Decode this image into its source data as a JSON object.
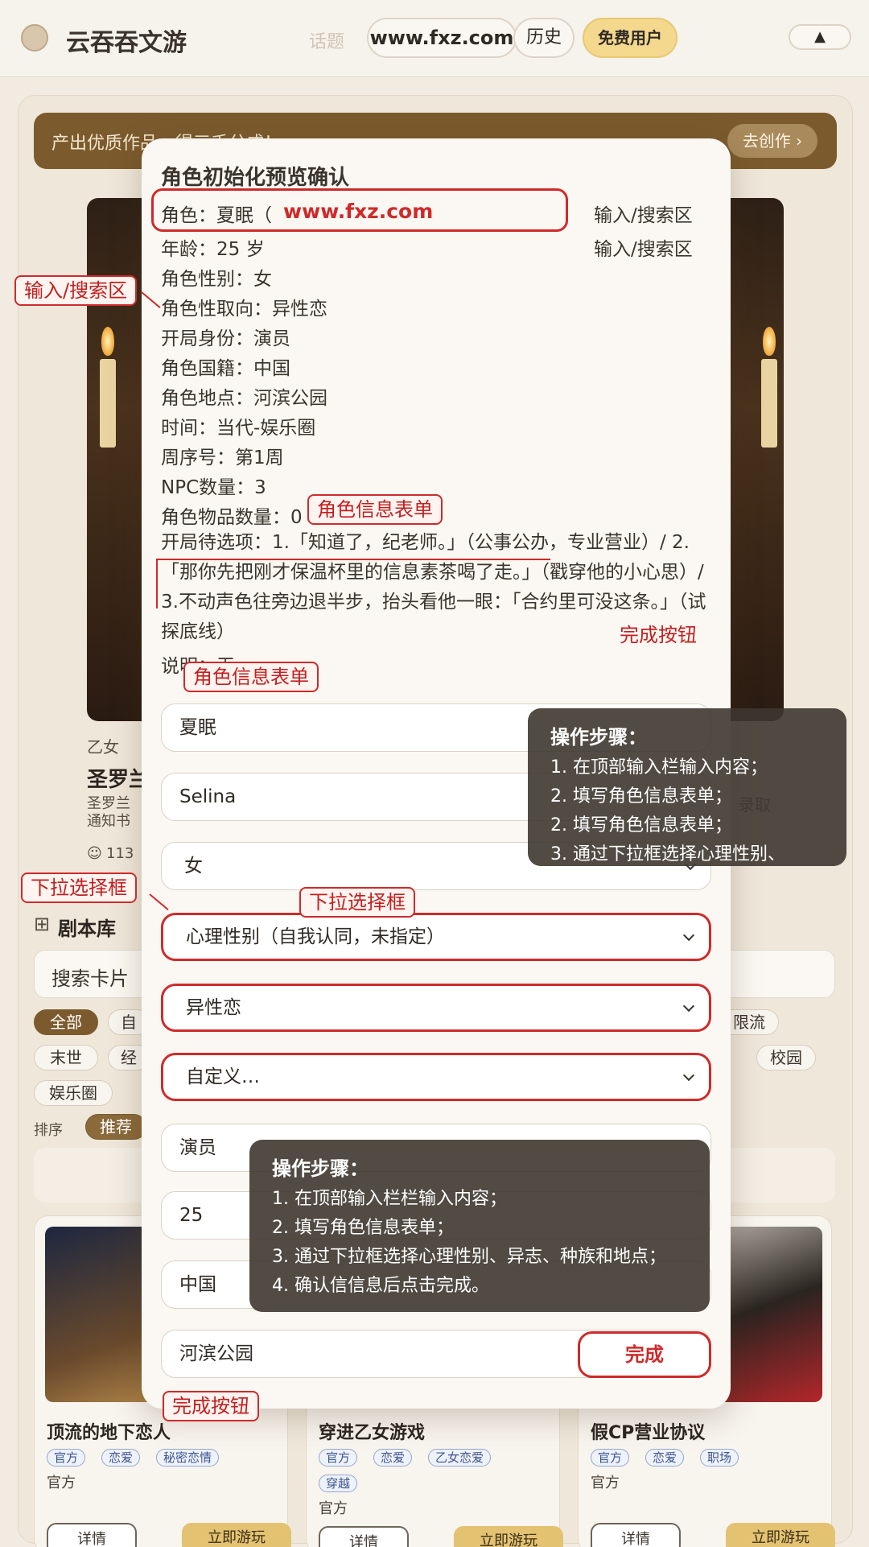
{
  "header": {
    "app_title": "云吞吞文游",
    "nav_ghost": "话题",
    "url_pill": "www.fxz.com",
    "history": "历史",
    "free_user": "免费用户",
    "up": "▲"
  },
  "banner": {
    "text": "产出优质作品，得三千分成！",
    "button": "去创作 ›"
  },
  "background": {
    "featured_genre": "乙女",
    "featured_title": "圣罗兰",
    "featured_sub1": "圣罗兰",
    "featured_sub2": "通知书",
    "featured_count": "113",
    "featured_right_link": "录取",
    "library_title": "剧本库",
    "search_placeholder": "搜索卡片",
    "chips_row1": [
      "全部",
      "自",
      "限流"
    ],
    "chips_row2": [
      "末世",
      "经",
      "校园"
    ],
    "chips_row3": [
      "娱乐圈"
    ],
    "sort_label": "排序",
    "sort_active": "推荐",
    "tiles": [
      {
        "title": "顶流的地下恋人",
        "tags": [
          "官方",
          "恋爱",
          "秘密恋情"
        ],
        "by": "官方",
        "detail": "详情",
        "cta": "立即游玩"
      },
      {
        "title": "穿进乙女游戏",
        "tags": [
          "官方",
          "恋爱",
          "乙女恋爱",
          "穿越"
        ],
        "by": "官方",
        "detail": "详情",
        "cta": "立即游玩"
      },
      {
        "title": "假CP营业协议",
        "tags": [
          "官方",
          "恋爱",
          "职场"
        ],
        "by": "官方",
        "detail": "详情",
        "cta": "立即游玩"
      }
    ]
  },
  "modal": {
    "title": "角色初始化预览确认",
    "lines": [
      "角色：夏眠（",
      "年龄：25 岁",
      "角色性别：女",
      "角色性取向：异性恋",
      "开局身份：演员",
      "角色国籍：中国",
      "角色地点：河滨公园",
      "时间：当代-娱乐圈",
      "周序号：第1周",
      "NPC数量：3",
      "角色物品数量：0"
    ],
    "url_in_field": "www.fxz.com",
    "options_text": "开局待选项：1.「知道了，纪老师。」（公事公办，专业营业）/ 2.「那你先把刚才保温杯里的信息素茶喝了走。」（戳穿他的小心思）/ 3.不动声色往旁边退半步，抬头看他一眼：「合约里可没这条。」（试探底线）",
    "note": "说明：无",
    "right_hint_1": "输入/搜索区",
    "right_hint_2": "输入/搜索区",
    "fields": {
      "name": "夏眠",
      "english_name": "Selina",
      "gender": "女",
      "psych_gender": "心理性别（自我认同，未指定）",
      "orientation": "异性恋",
      "custom": "自定义…",
      "identity": "演员",
      "age": "25",
      "nationality": "中国",
      "location": "河滨公园"
    },
    "done_button": "完成"
  },
  "annotations": {
    "input_search": "输入/搜索区",
    "role_form_1": "角色信息表单",
    "role_form_2": "角色信息表单",
    "done_hint_right": "完成按钮",
    "done_hint_bottom": "完成按钮",
    "dropdown_left": "下拉选择框",
    "dropdown_mid": "下拉选择框",
    "steps_a": {
      "heading": "操作步骤：",
      "items": [
        "1.  在顶部输入栏输入内容；",
        "2. 填写角色信息表单；",
        "2. 填写角色信息表单；",
        "3. 通过下拉框选择心理性别、"
      ]
    },
    "steps_b": {
      "heading": "操作步骤：",
      "items": [
        "1. 在顶部输入栏栏输入内容；",
        "2. 填写角色信息表单；",
        "3. 通过下拉框选择心理性别、异志、种族和地点；",
        "4. 确认信信息后点击完成。"
      ]
    }
  },
  "colors": {
    "accent_red": "#cf2a2a",
    "brown": "#7b5b2e",
    "gold": "#f3d88e"
  }
}
